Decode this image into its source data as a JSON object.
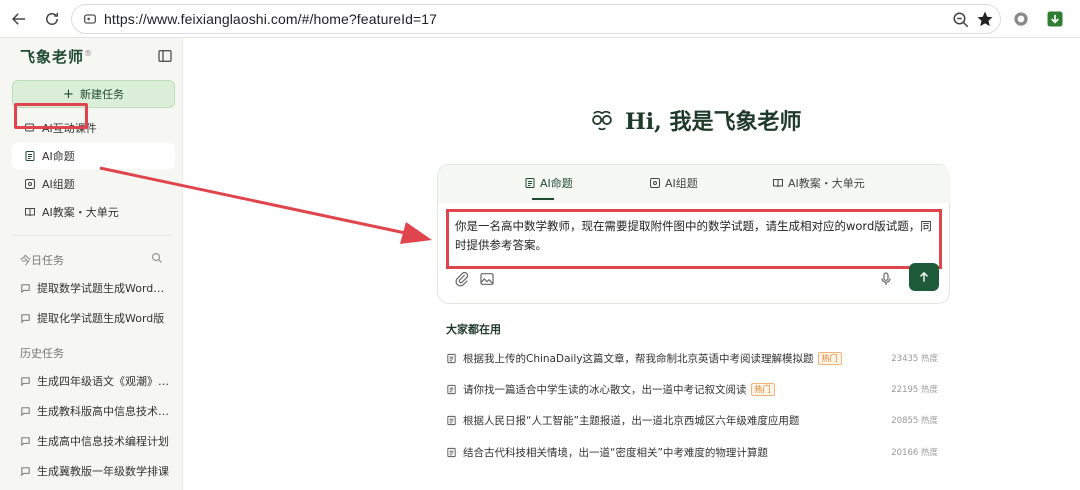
{
  "browser": {
    "url": "https://www.feixianglaoshi.com/#/home?featureId=17"
  },
  "sidebar": {
    "brand": "飞象老师",
    "brand_mark": "®",
    "new_task_label": "新建任务",
    "nav": [
      {
        "label": "AI互动课件"
      },
      {
        "label": "AI命题"
      },
      {
        "label": "AI组题"
      },
      {
        "label": "AI教案・大单元"
      }
    ],
    "today_title": "今日任务",
    "today_tasks": [
      "提取数学试题生成Word版试题",
      "提取化学试题生成Word版"
    ],
    "history_title": "历史任务",
    "history_tasks": [
      "生成四年级语文《观潮》课件",
      "生成教科版高中信息技术课件",
      "生成高中信息技术编程计划",
      "生成冀教版一年级数学排课"
    ]
  },
  "main": {
    "hero_title": "Hi, 我是飞象老师",
    "tabs": [
      {
        "label": "AI命题"
      },
      {
        "label": "AI组题"
      },
      {
        "label": "AI教案・大单元"
      }
    ],
    "prompt_text": "你是一名高中数学教师，现在需要提取附件图中的数学试题，请生成相对应的word版试题，同时提供参考答案。",
    "popular_title": "大家都在用",
    "popular": [
      {
        "text": "根据我上传的ChinaDaily这篇文章，帮我命制北京英语中考阅读理解模拟题",
        "badge": "热门",
        "heat": "23435 热度"
      },
      {
        "text": "请你找一篇适合中学生读的冰心散文，出一道中考记叙文阅读",
        "badge": "热门",
        "heat": "22195 热度"
      },
      {
        "text": "根据人民日报“人工智能”主题报道，出一道北京西城区六年级难度应用题",
        "badge": "",
        "heat": "20855 热度"
      },
      {
        "text": "结合古代科技相关情境，出一道“密度相关”中考难度的物理计算题",
        "badge": "",
        "heat": "20166 热度"
      }
    ]
  },
  "colors": {
    "brand_green": "#1f4a32",
    "highlight_red": "#e0444d",
    "hot_orange": "#e87a1f"
  },
  "icons": [
    "back-arrow-icon",
    "reload-icon",
    "lock-icon",
    "zoom-icon",
    "star-icon",
    "extension-icon",
    "sidebar-collapse-icon",
    "search-icon",
    "paperclip-icon",
    "image-icon",
    "microphone-icon",
    "send-arrow-icon"
  ]
}
